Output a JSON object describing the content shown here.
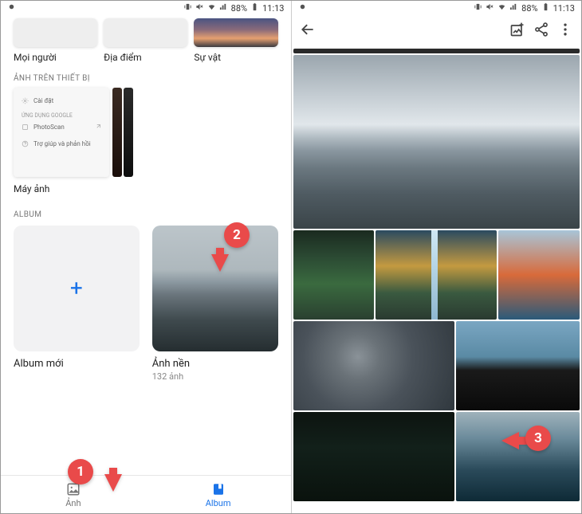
{
  "status": {
    "battery_pct": "88%",
    "time": "11:13"
  },
  "left": {
    "top_cards": {
      "people": "Mọi người",
      "places": "Địa điểm",
      "things": "Sự vật"
    },
    "section_device": "ẢNH TRÊN THIẾT BỊ",
    "device_menu": {
      "settings": "Cài đặt",
      "google_apps": "ỨNG DỤNG GOOGLE",
      "photoscan": "PhotoScan",
      "help": "Trợ giúp và phản hồi"
    },
    "camera_label": "Máy ảnh",
    "section_album": "ALBUM",
    "album_new": "Album mới",
    "album_name": "Ảnh nền",
    "album_count": "132 ảnh",
    "nav": {
      "photos": "Ảnh",
      "album": "Album"
    }
  },
  "markers": {
    "one": "1",
    "two": "2",
    "three": "3"
  }
}
